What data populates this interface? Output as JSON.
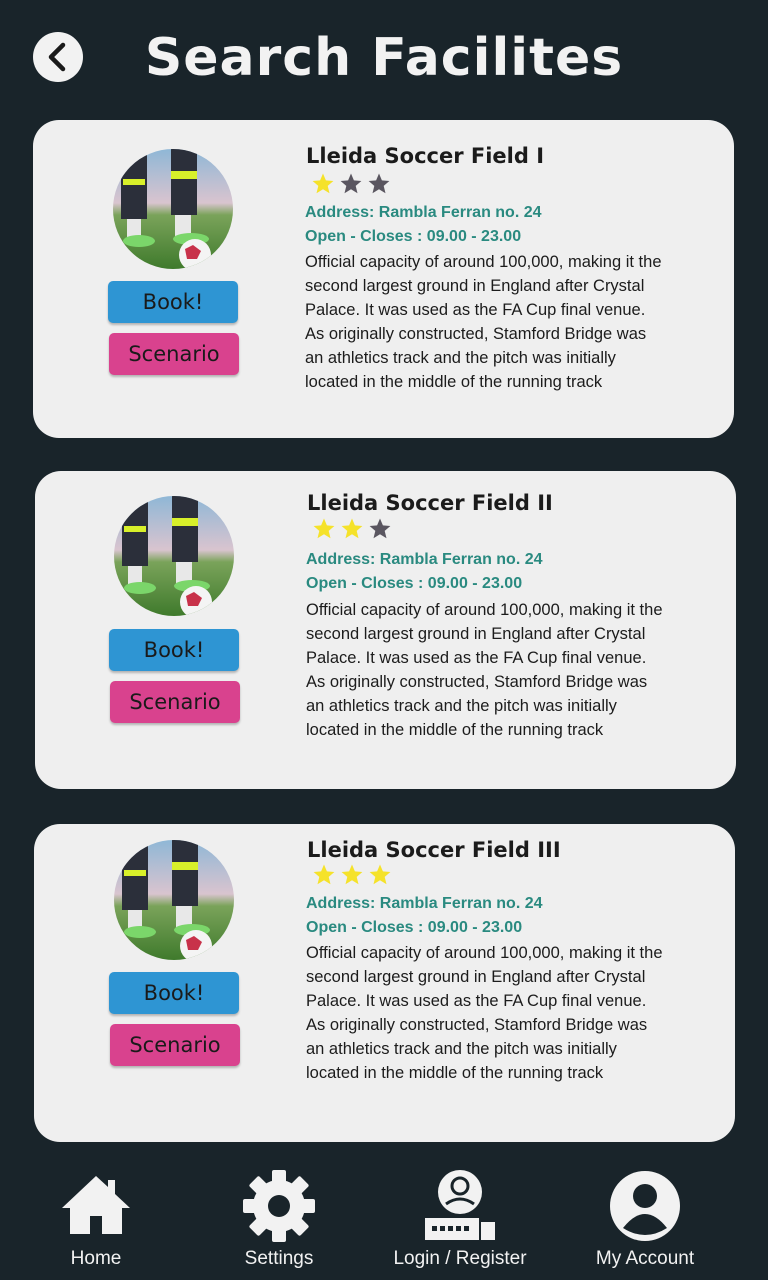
{
  "header": {
    "title": "Search Facilites"
  },
  "facilities": [
    {
      "name": "Lleida Soccer Field I",
      "rating": 1,
      "address": "Address: Rambla Ferran no. 24",
      "hours": "Open - Closes : 09.00 - 23.00",
      "description": "Official capacity of around 100,000, making it the second largest ground in England after Crystal Palace. It was used as the FA Cup final venue. As originally constructed, Stamford Bridge was an athletics track and the pitch was initially located in the middle of the running track",
      "book_label": "Book!",
      "scenario_label": "Scenario"
    },
    {
      "name": "Lleida Soccer Field II",
      "rating": 2,
      "address": "Address: Rambla Ferran no. 24",
      "hours": "Open - Closes : 09.00 - 23.00",
      "description": "Official capacity of around 100,000, making it the second largest ground in England after Crystal Palace. It was used as the FA Cup final venue. As originally constructed, Stamford Bridge was an athletics track and the pitch was initially located in the middle of the running track",
      "book_label": "Book!",
      "scenario_label": "Scenario"
    },
    {
      "name": "Lleida Soccer Field III",
      "rating": 3,
      "address": "Address: Rambla Ferran no. 24",
      "hours": "Open - Closes : 09.00 - 23.00",
      "description": "Official capacity of around 100,000, making it the second largest ground in England after Crystal Palace. It was used as the FA Cup final venue. As originally constructed, Stamford Bridge was an athletics track and the pitch was initially located in the middle of the running track",
      "book_label": "Book!",
      "scenario_label": "Scenario"
    }
  ],
  "rating_max": 3,
  "colors": {
    "background": "#19242a",
    "card": "#efefef",
    "book": "#2e95d3",
    "scenario": "#d9428e",
    "accent_text": "#2a8a80",
    "star_on": "#f5e22a",
    "star_off": "#5a5660"
  },
  "nav": {
    "home": {
      "label": "Home",
      "icon": "home-icon"
    },
    "settings": {
      "label": "Settings",
      "icon": "gear-icon"
    },
    "login": {
      "label": "Login / Register",
      "icon": "login-icon"
    },
    "account": {
      "label": "My Account",
      "icon": "account-icon"
    }
  }
}
